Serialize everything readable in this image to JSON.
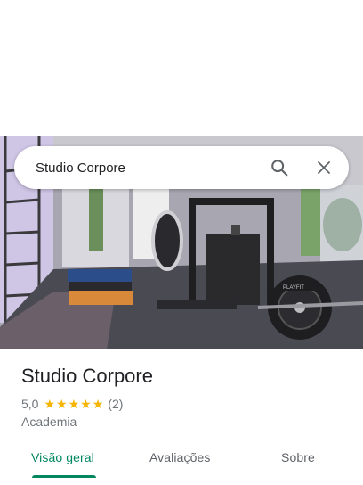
{
  "search": {
    "query": "Studio Corpore"
  },
  "place": {
    "name": "Studio Corpore",
    "rating": "5,0",
    "stars": 5,
    "review_count": "(2)",
    "category": "Academia"
  },
  "photo": {
    "plate_text": "PLAYFIT"
  },
  "tabs": [
    {
      "label": "Visão geral",
      "active": true
    },
    {
      "label": "Avaliações",
      "active": false
    },
    {
      "label": "Sobre",
      "active": false
    }
  ],
  "colors": {
    "accent": "#01875f",
    "star": "#f4b400"
  }
}
